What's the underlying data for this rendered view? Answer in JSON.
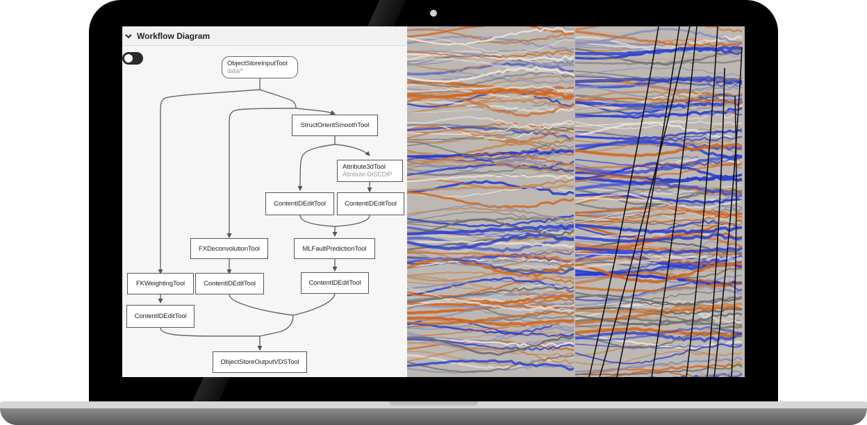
{
  "panel": {
    "title": "Workflow Diagram"
  },
  "nodes": {
    "input": {
      "label": "ObjectStoreInputTool",
      "sub": "data/*"
    },
    "struct_orient": {
      "label": "StructOrientSmoothTool"
    },
    "attribute3d": {
      "label": "Attribute3dTool",
      "sub": "Attribute-DISCDIP"
    },
    "content_edit_1": {
      "label": "ContentIDEditTool"
    },
    "content_edit_2": {
      "label": "ContentIDEditTool"
    },
    "fx_deconvolution": {
      "label": "FXDeconvolutionTool"
    },
    "ml_fault_prediction": {
      "label": "MLFaultPredictionTool"
    },
    "fk_weighting": {
      "label": "FKWeightingTool"
    },
    "content_edit_3": {
      "label": "ContentIDEditTool"
    },
    "content_edit_4": {
      "label": "ContentIDEditTool"
    },
    "content_edit_5": {
      "label": "ContentIDEditTool"
    },
    "output": {
      "label": "ObjectStoreOutputVDSTool"
    }
  },
  "colors": {
    "seismic_orange": "#d2661e",
    "seismic_blue": "#2b3fd0",
    "seismic_gray": "#a9a9a9",
    "fault_line": "#111111"
  }
}
